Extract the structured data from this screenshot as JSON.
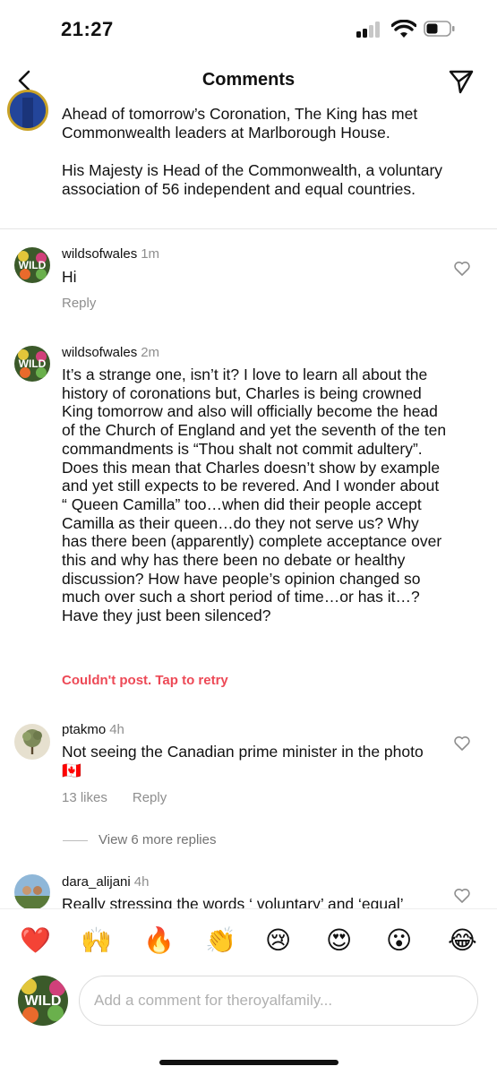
{
  "status_bar": {
    "time": "21:27"
  },
  "header": {
    "title": "Comments",
    "back_icon": "chevron-left-icon",
    "send_icon": "send-icon"
  },
  "caption": {
    "paragraphs": [
      "Ahead of tomorrow’s Coronation, The King has met Commonwealth leaders at Marlborough House.",
      "His Majesty is Head of the Commonwealth, a voluntary association of 56 independent and equal countries."
    ]
  },
  "comments": [
    {
      "username": "wildsofwales",
      "time": "1m",
      "text": "Hi",
      "reply_label": "Reply"
    },
    {
      "username": "wildsofwales",
      "time": "2m",
      "text": "It’s a strange one, isn’t it? I love to learn all about the history of coronations but, Charles is being crowned King tomorrow and also will officially become the head of the Church of England and yet the seventh of the ten commandments is “Thou shalt not commit adultery”. Does this mean that Charles doesn’t show by example and yet still expects to be revered. And I wonder about “ Queen Camilla” too…when did their people accept Camilla as their queen…do they not serve us? Why has there been (apparently) complete acceptance over this and why has there been no debate or healthy discussion? How have people’s opinion changed so much over such a short period of time…or has it…? Have they just been silenced?",
      "error_label": "Couldn't post. Tap to retry"
    },
    {
      "username": "ptakmo",
      "time": "4h",
      "text": "Not seeing the Canadian prime minister in the photo 🇨🇦",
      "likes_label": "13 likes",
      "reply_label": "Reply"
    },
    {
      "username": "dara_alijani",
      "time": "4h",
      "text": "Really stressing the words ‘ voluntary’ and ‘equal’"
    }
  ],
  "view_replies_label": "View 6 more replies",
  "emoji_bar": [
    "❤️",
    "🙌",
    "🔥",
    "👏",
    "😢",
    "😍",
    "😮",
    "😂"
  ],
  "composer": {
    "placeholder": "Add a comment for theroyalfamily..."
  },
  "colors": {
    "error": "#ed4956",
    "secondary_text": "#8e8e8e",
    "caption_avatar_ring": "#c9a227"
  }
}
